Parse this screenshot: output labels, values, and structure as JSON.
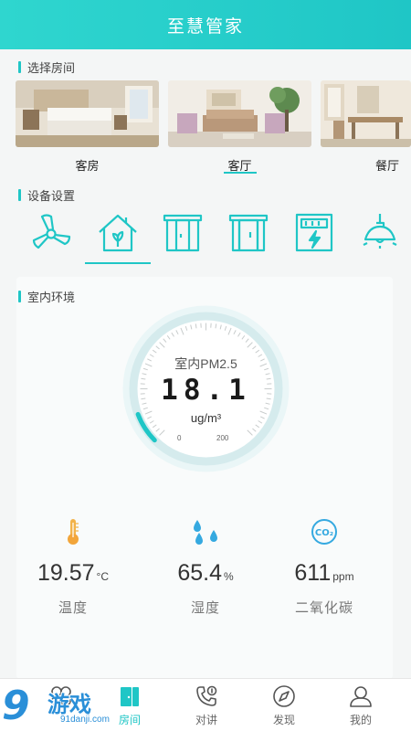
{
  "header": {
    "title": "至慧管家"
  },
  "rooms_section": {
    "label": "选择房间"
  },
  "rooms": [
    {
      "label": "客房",
      "active": false
    },
    {
      "label": "客厅",
      "active": true
    },
    {
      "label": "餐厅",
      "active": false
    }
  ],
  "devices_section": {
    "label": "设备设置"
  },
  "devices": [
    {
      "icon": "fan-icon",
      "active": false
    },
    {
      "icon": "home-icon",
      "active": true
    },
    {
      "icon": "curtain-icon",
      "active": false
    },
    {
      "icon": "curtain-icon",
      "active": false
    },
    {
      "icon": "power-meter-icon",
      "active": false
    },
    {
      "icon": "ceiling-lamp-icon",
      "active": false
    }
  ],
  "environment": {
    "label": "室内环境",
    "pm25": {
      "title": "室内PM2.5",
      "value": "18.1",
      "unit": "ug/m³",
      "min": "0",
      "max": "200"
    },
    "metrics": [
      {
        "icon": "thermometer-icon",
        "value": "19.57",
        "unit": "°C",
        "label": "温度"
      },
      {
        "icon": "water-drops-icon",
        "value": "65.4",
        "unit": "%",
        "label": "湿度"
      },
      {
        "icon": "co2-icon",
        "value": "611",
        "unit": "ppm",
        "label": "二氧化碳"
      }
    ]
  },
  "tabbar": {
    "tabs": [
      {
        "label": "",
        "icon": "home-tab-icon",
        "active": false
      },
      {
        "label": "房间",
        "icon": "room-tab-icon",
        "active": true
      },
      {
        "label": "对讲",
        "icon": "intercom-icon",
        "active": false
      },
      {
        "label": "发现",
        "icon": "compass-icon",
        "active": false
      },
      {
        "label": "我的",
        "icon": "user-icon",
        "active": false
      }
    ]
  },
  "watermark": {
    "logo": "9",
    "name": "游戏",
    "url": "91danji.com"
  },
  "colors": {
    "accent": "#1fc6c6",
    "background": "#f4f6f6"
  }
}
